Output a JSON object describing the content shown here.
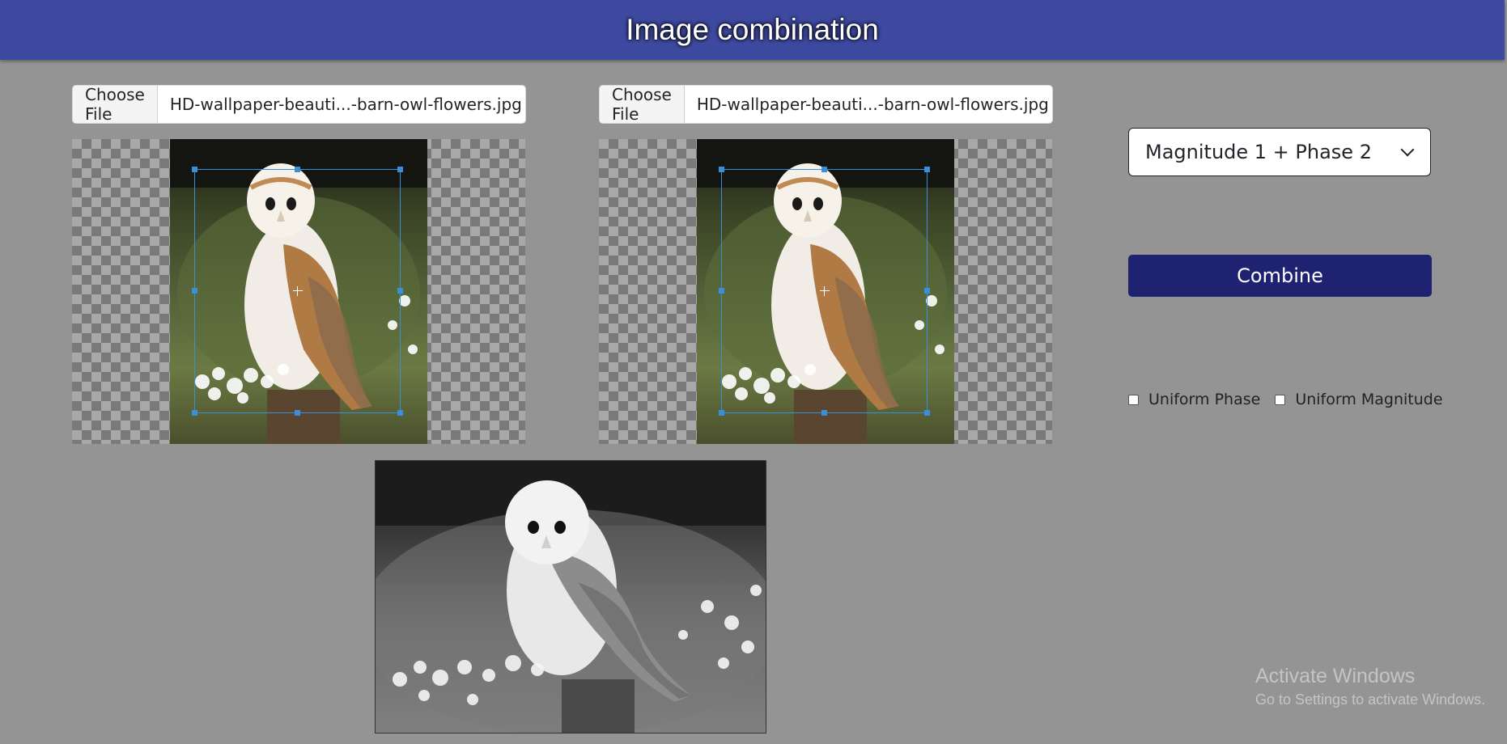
{
  "header": {
    "title": "Image combination"
  },
  "image1": {
    "choose_label": "Choose File",
    "file_name": "HD-wallpaper-beauti...-barn-owl-flowers.jpg"
  },
  "image2": {
    "choose_label": "Choose File",
    "file_name": "HD-wallpaper-beauti...-barn-owl-flowers.jpg"
  },
  "mode_select": {
    "value": "Magnitude 1 + Phase 2"
  },
  "combine_button": {
    "label": "Combine"
  },
  "options": {
    "uniform_phase": {
      "label": "Uniform Phase",
      "checked": false
    },
    "uniform_magnitude": {
      "label": "Uniform Magnitude",
      "checked": false
    }
  },
  "watermark": {
    "line1": "Activate Windows",
    "line2": "Go to Settings to activate Windows."
  },
  "colors": {
    "header": "#3e49a0",
    "button": "#1f2270",
    "crop_frame": "#3a8fd8",
    "background": "#949494"
  },
  "icons": [
    "chevron-down-icon",
    "crosshair-icon"
  ]
}
